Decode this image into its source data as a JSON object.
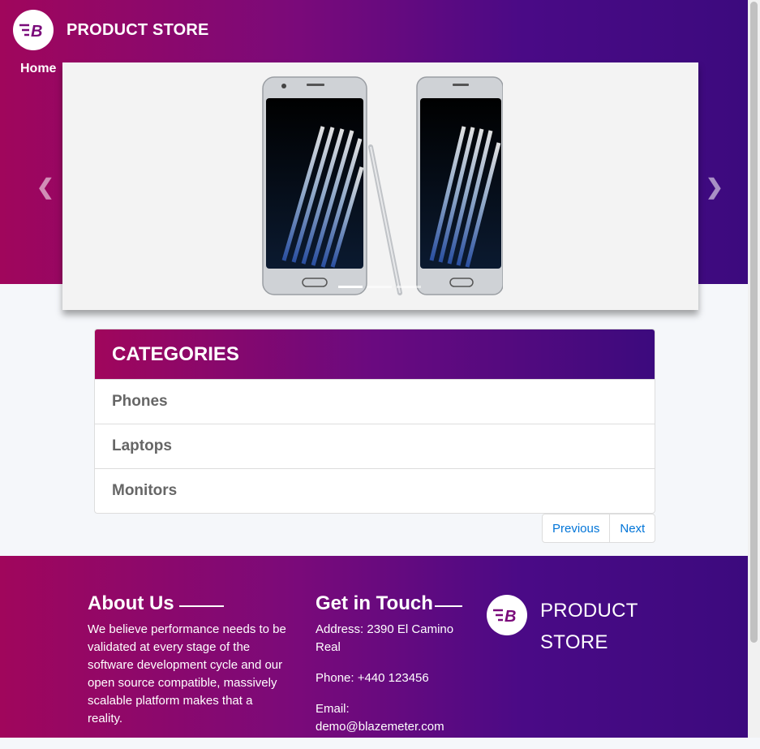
{
  "brand": {
    "name": "PRODUCT STORE",
    "logo_letter": "B"
  },
  "nav": {
    "home": "Home"
  },
  "carousel": {
    "image": "samsung-galaxy-note7-phones",
    "prev_icon": "chevron-left-icon",
    "next_icon": "chevron-right-icon",
    "slide_count": 3,
    "active_slide": 1
  },
  "categories": {
    "title": "CATEGORIES",
    "items": [
      {
        "label": "Phones"
      },
      {
        "label": "Laptops"
      },
      {
        "label": "Monitors"
      }
    ]
  },
  "pagination": {
    "previous": "Previous",
    "next": "Next"
  },
  "footer": {
    "about_title": "About Us",
    "about_text": "We believe performance needs to be validated at every stage of the software development cycle and our open source compatible, massively scalable platform makes that a reality.",
    "touch_title": "Get in Touch",
    "address": "Address: 2390 El Camino Real",
    "phone": "Phone: +440 123456",
    "email": "Email: demo@blazemeter.com",
    "brand_name": "PRODUCT STORE"
  },
  "colors": {
    "primary_magenta": "#a0065c",
    "primary_purple": "#3c0a7e",
    "link_blue": "#0275d8"
  }
}
